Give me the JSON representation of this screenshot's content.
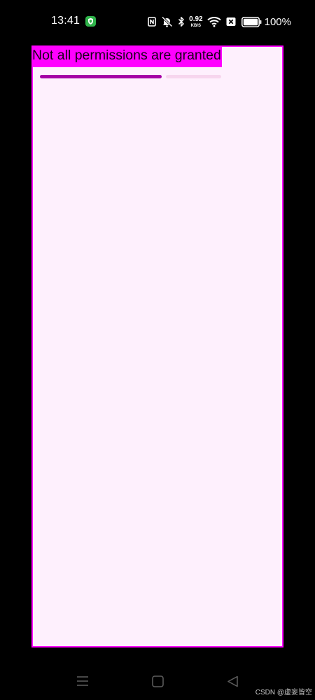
{
  "status_bar": {
    "time": "13:41",
    "network_speed_value": "0.92",
    "network_speed_unit": "KB/S",
    "battery_percent": "100%",
    "battery_level": 1.0,
    "icons": [
      "shield-icon",
      "nfc-icon",
      "mute-bell-icon",
      "bluetooth-icon",
      "wifi-icon",
      "no-sim-icon",
      "battery-icon"
    ]
  },
  "app": {
    "title": "Not all permissions are granted",
    "progress_fraction": 0.67,
    "colors": {
      "background": "#fef0fd",
      "accent": "#ff00ff",
      "progress": "#a600a6",
      "progress_track": "#f7d6ee"
    }
  },
  "nav_bar": {
    "icons": [
      "menu-icon",
      "home-square-icon",
      "back-triangle-icon"
    ]
  },
  "watermark": "CSDN @虚妄皆空"
}
